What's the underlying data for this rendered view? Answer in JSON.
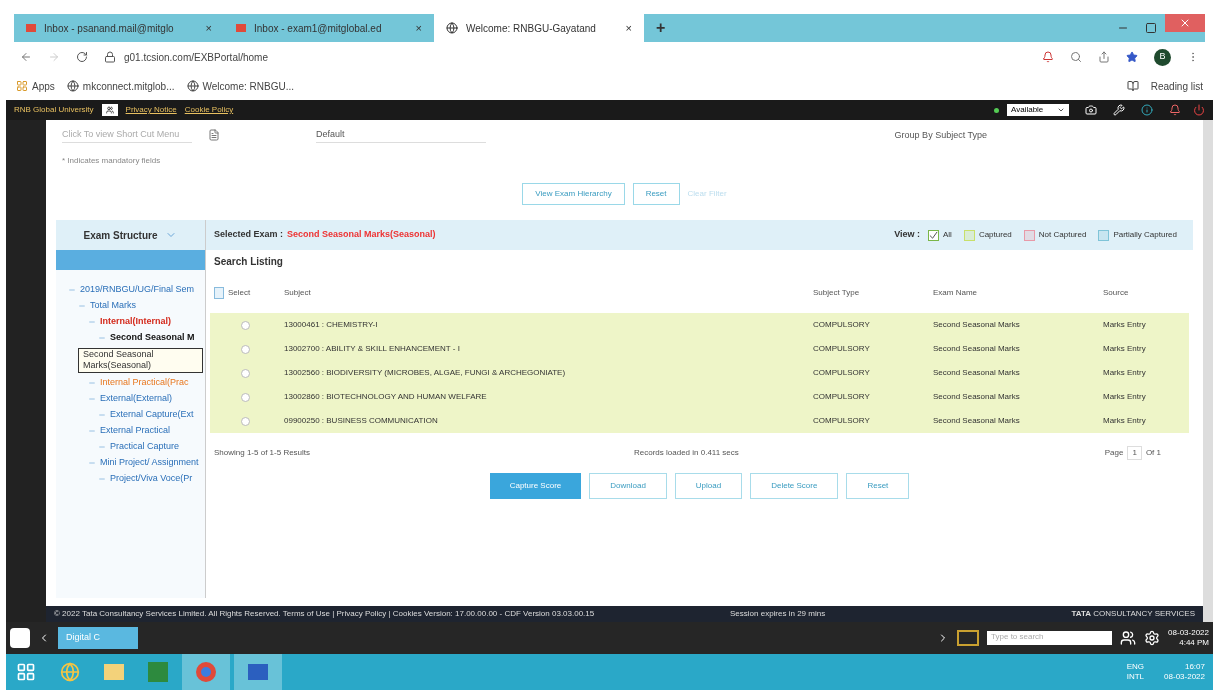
{
  "browser": {
    "tabs": [
      {
        "title": "Inbox - psanand.mail@mitglo",
        "close": "×",
        "selected": false
      },
      {
        "title": "Inbox - exam1@mitglobal.ed",
        "close": "×",
        "selected": false
      },
      {
        "title": "Welcome: RNBGU-Gayatand",
        "close": "×",
        "selected": true
      }
    ],
    "new_tab": "+",
    "url": "g01.tcsion.com/EXBPortal/home",
    "bookmarks": [
      "Apps",
      "mkconnect.mitglob...",
      "Welcome: RNBGU..."
    ],
    "reading_list": "Reading list",
    "profile": "B"
  },
  "app_header": {
    "org": "RNB Global University",
    "links": [
      "Privacy Notice",
      "Cookie Policy"
    ],
    "status": "Available"
  },
  "filters": {
    "shortcut_placeholder": "Click To view Short Cut Menu",
    "grouping": "Default",
    "group_by": "Group By Subject Type",
    "mandatory_note": "* Indicates mandatory fields",
    "buttons": [
      "View Exam Hierarchy",
      "Reset"
    ],
    "clear_link": "Clear Filter"
  },
  "sidebar": {
    "title": "Exam Structure",
    "tree": [
      {
        "label": "2019/RNBGU/UG/Final Sem",
        "kind": "link",
        "selected": false,
        "children": [
          {
            "label": "Total Marks",
            "kind": "link",
            "selected": false,
            "children": [
              {
                "label": "Internal(Internal)",
                "kind": "active",
                "selected": false,
                "children": [
                  {
                    "label": "Second Seasonal M",
                    "selected": true
                  }
                ]
              },
              {
                "label": "Internal Practical(Prac",
                "kind": "pending",
                "selected": false
              },
              {
                "label": "External(External)",
                "kind": "link",
                "selected": false,
                "children": [
                  {
                    "label": "External Capture(Ext",
                    "kind": "link",
                    "selected": false
                  }
                ]
              },
              {
                "label": "External Practical",
                "kind": "link",
                "selected": false,
                "children": [
                  {
                    "label": "Practical Capture",
                    "kind": "link",
                    "selected": false
                  }
                ]
              },
              {
                "label": "Mini Project/ Assignment",
                "kind": "link",
                "selected": false,
                "children": [
                  {
                    "label": "Project/Viva Voce(Pr",
                    "kind": "link",
                    "selected": false
                  }
                ]
              }
            ]
          }
        ]
      }
    ],
    "tooltip": "Second Seasonal Marks(Seasonal)"
  },
  "main": {
    "selected_label": "Selected Exam :",
    "selected_exam": "Second Seasonal Marks(Seasonal)",
    "view_label": "View :",
    "view_options": [
      {
        "label": "All",
        "checked": true,
        "color": "#7ab648"
      },
      {
        "label": "Captured",
        "checked": false,
        "color": "#c8e06a"
      },
      {
        "label": "Not Captured",
        "checked": false,
        "color": "#e89aa8"
      },
      {
        "label": "Partially Captured",
        "checked": false,
        "color": "#7fc4d8"
      }
    ],
    "listing_title": "Search Listing",
    "table": {
      "columns": [
        "Select",
        "Subject",
        "Subject Type",
        "Exam Name",
        "Source"
      ],
      "rows": [
        {
          "subject": "13000461 : CHEMISTRY-I",
          "type": "COMPULSORY",
          "exam": "Second Seasonal Marks",
          "source": "Marks Entry",
          "selected": false
        },
        {
          "subject": "13002700 : ABILITY & SKILL ENHANCEMENT - I",
          "type": "COMPULSORY",
          "exam": "Second Seasonal Marks",
          "source": "Marks Entry",
          "selected": false
        },
        {
          "subject": "13002560 : BIODIVERSITY (MICROBES, ALGAE, FUNGI & ARCHEGONIATE)",
          "type": "COMPULSORY",
          "exam": "Second Seasonal Marks",
          "source": "Marks Entry",
          "selected": false
        },
        {
          "subject": "13002860 : BIOTECHNOLOGY AND HUMAN WELFARE",
          "type": "COMPULSORY",
          "exam": "Second Seasonal Marks",
          "source": "Marks Entry",
          "selected": false
        },
        {
          "subject": "09900250 : BUSINESS COMMUNICATION",
          "type": "COMPULSORY",
          "exam": "Second Seasonal Marks",
          "source": "Marks Entry",
          "selected": false
        }
      ]
    },
    "showing": "Showing 1-5 of 1-5 Results",
    "records": "Records loaded in 0.411 secs",
    "page_label": "Page",
    "page": "1",
    "page_of": "Of 1",
    "actions": [
      {
        "label": "Capture Score",
        "primary": true
      },
      {
        "label": "Download",
        "primary": false
      },
      {
        "label": "Upload",
        "primary": false
      },
      {
        "label": "Delete Score",
        "primary": false
      },
      {
        "label": "Reset",
        "primary": false
      }
    ]
  },
  "footer": {
    "copyright": "© 2022 Tata Consultancy Services Limited. All Rights Reserved.  Terms of Use | Privacy Policy | Cookies Version: 17.00.00.00 - CDF Version 03.03.00.15",
    "session": "Session expires in 29 mins",
    "brand_bold": "TATA",
    "brand": "CONSULTANCY SERVICES"
  },
  "app_bar": {
    "tab": "Digital C",
    "search_placeholder": "Type to search",
    "date": "08-03-2022",
    "time": "4:44 PM"
  },
  "taskbar": {
    "lang": "ENG",
    "layout": "INTL",
    "time": "16:07",
    "date": "08-03-2022"
  }
}
